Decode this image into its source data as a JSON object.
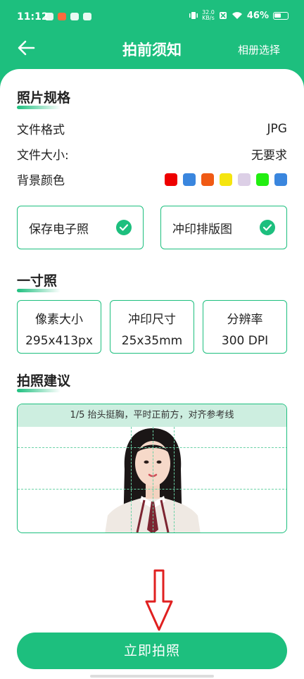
{
  "status": {
    "time": "11:12",
    "net_speed_top": "32.0",
    "net_speed_unit": "KB/s",
    "battery": "46%"
  },
  "nav": {
    "title": "拍前须知",
    "album": "相册选择"
  },
  "spec_section": {
    "title": "照片规格",
    "format_label": "文件格式",
    "format_value": "JPG",
    "size_label": "文件大小:",
    "size_value": "无要求",
    "bg_label": "背景颜色",
    "bg_colors": [
      "#ee0000",
      "#3a86de",
      "#f05a14",
      "#f5e50f",
      "#dccfe6",
      "#22ee11",
      "#3a86de"
    ]
  },
  "options": [
    {
      "label": "保存电子照",
      "checked": true
    },
    {
      "label": "冲印排版图",
      "checked": true
    }
  ],
  "size_section": {
    "title": "一寸照",
    "items": [
      {
        "key": "像素大小",
        "value": "295x413px"
      },
      {
        "key": "冲印尺寸",
        "value": "25x35mm"
      },
      {
        "key": "分辨率",
        "value": "300 DPI"
      }
    ]
  },
  "advice": {
    "title": "拍照建议",
    "tip": "1/5  抬头挺胸，平时正前方，对齐参考线"
  },
  "action": {
    "label": "立即拍照"
  },
  "colors": {
    "accent": "#1dbf7e",
    "arrow": "#e02020"
  }
}
